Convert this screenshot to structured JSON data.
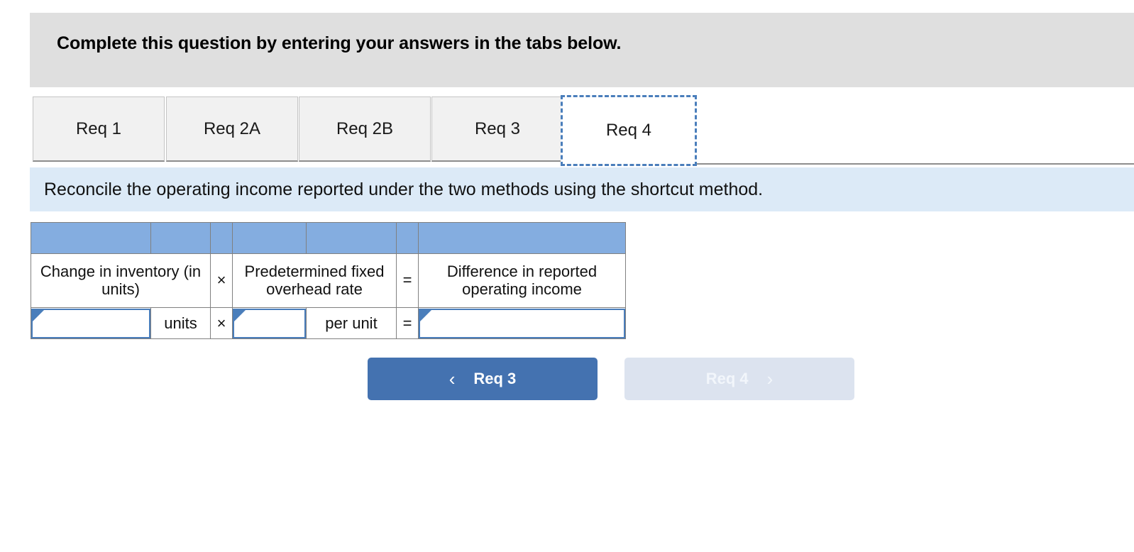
{
  "header": {
    "title": "Complete this question by entering your answers in the tabs below.",
    "background": "#dfdfdf"
  },
  "tabs": {
    "items": [
      {
        "label": "Req 1",
        "active": false
      },
      {
        "label": "Req 2A",
        "active": false
      },
      {
        "label": "Req 2B",
        "active": false
      },
      {
        "label": "Req 3",
        "active": false
      },
      {
        "label": "Req 4",
        "active": true
      }
    ],
    "active_index": 4,
    "focus_outline_color": "#4a7ebb"
  },
  "instruction": {
    "text": "Reconcile the operating income reported under the two methods using the shortcut method.",
    "background": "#dceaf7"
  },
  "table": {
    "band_color": "#84ade0",
    "border_color": "#808080",
    "headers": {
      "change_in_inventory": "Change in inventory (in units)",
      "operator_multiply_1": "×",
      "predetermined_rate": "Predetermined fixed overhead rate",
      "operator_equals_1": "=",
      "difference_income": "Difference in reported operating income"
    },
    "input_row": {
      "change_in_inventory_value": "",
      "change_in_inventory_unit": "units",
      "operator_multiply": "×",
      "predetermined_rate_value": "",
      "predetermined_rate_unit": "per unit",
      "operator_equals": "=",
      "difference_income_value": ""
    },
    "input_border_color": "#4a7ebb"
  },
  "nav": {
    "prev": {
      "label": "Req 3",
      "chevron": "‹",
      "state": "enabled",
      "background": "#4472b0"
    },
    "next": {
      "label": "Req 4",
      "chevron": "›",
      "state": "disabled",
      "background": "#dce3ef"
    }
  }
}
